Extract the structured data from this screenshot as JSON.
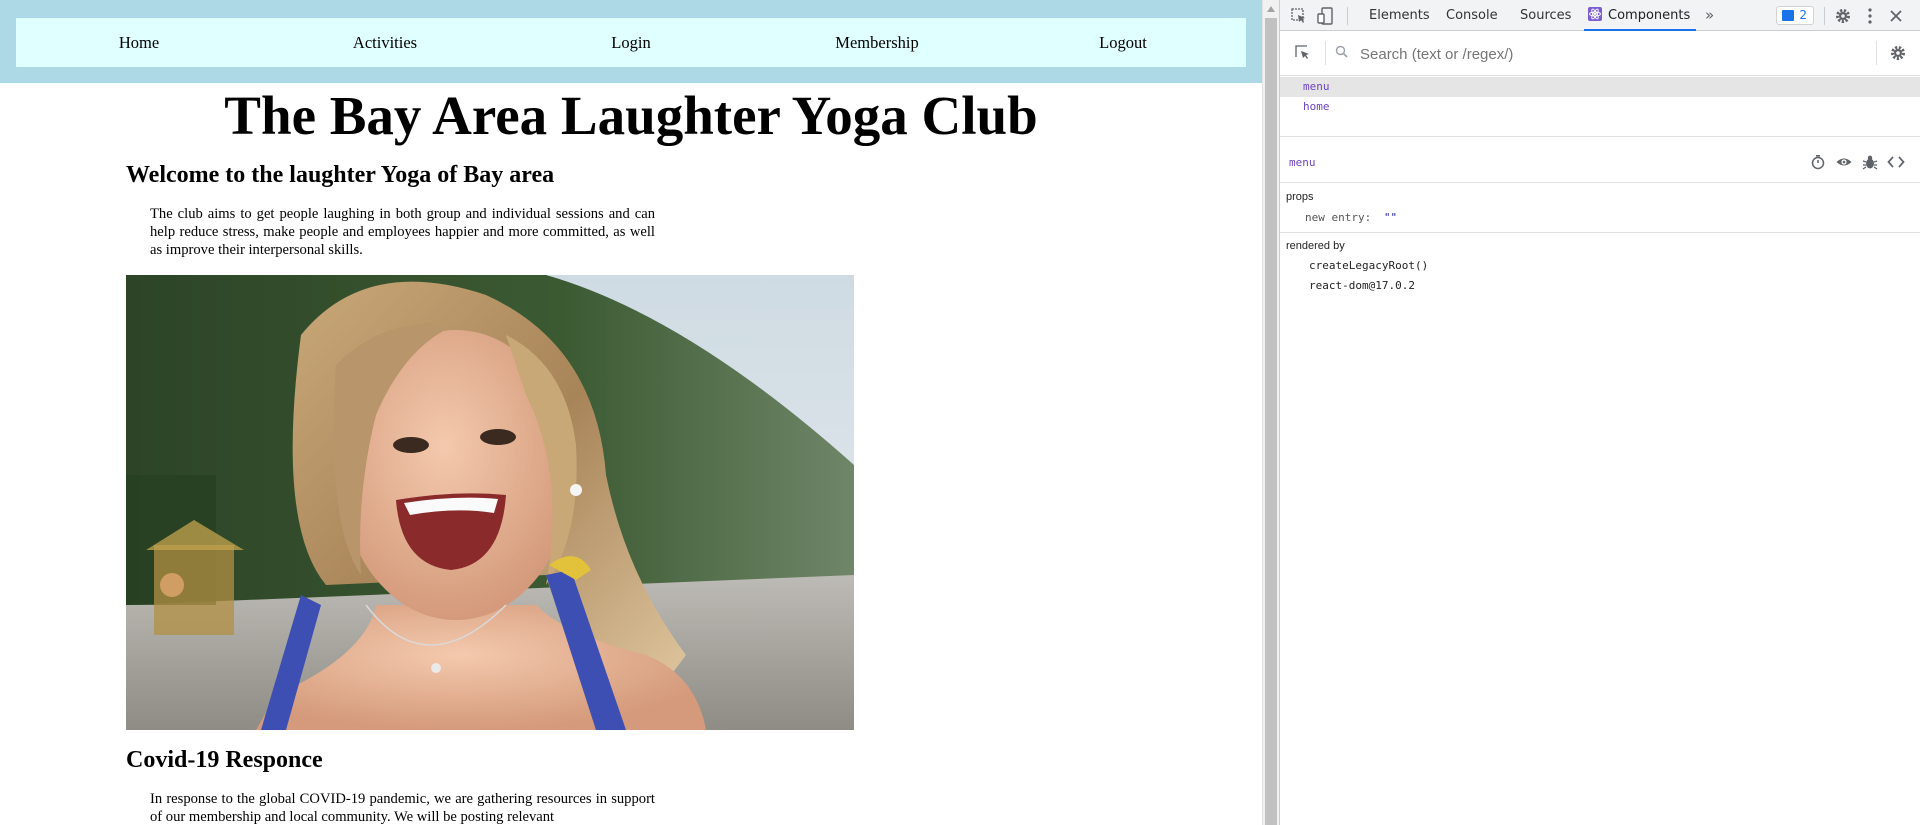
{
  "nav": {
    "items": [
      "Home",
      "Activities",
      "Login",
      "Membership",
      "Logout"
    ]
  },
  "site": {
    "title": "The Bay Area Laughter Yoga Club",
    "welcome_heading": "Welcome to the laughter Yoga of Bay area",
    "welcome_text": "The club aims to get people laughing in both group and individual sessions and can help reduce stress, make people and employees happier and more committed, as well as improve their interpersonal skills.",
    "covid_heading": "Covid-19 Responce",
    "covid_text": "In response to the global COVID-19 pandemic, we are gathering resources in support of our membership and local community. We will be posting relevant"
  },
  "devtools": {
    "tabs": [
      "Elements",
      "Console",
      "Sources",
      "Components"
    ],
    "active_tab": "Components",
    "issues_count": "2",
    "search_placeholder": "Search (text or /regex/)",
    "tree": [
      "menu",
      "home"
    ],
    "selected_component": "menu",
    "props_label": "props",
    "prop_key": "new entry:",
    "prop_value": "\"\"",
    "rendered_by_label": "rendered by",
    "rendered_by": [
      "createLegacyRoot()",
      "react-dom@17.0.2"
    ]
  },
  "colors": {
    "nav_band": "#add8e6",
    "nav_bar": "#e0ffff",
    "devtools_accent": "#1a73e8",
    "component_name": "#6f42c1"
  },
  "icons": [
    "inspect-element-icon",
    "device-toolbar-icon",
    "react-components-icon",
    "more-tabs-icon",
    "issues-icon",
    "settings-gear-icon",
    "kebab-menu-icon",
    "close-icon",
    "select-component-icon",
    "search-icon",
    "stopwatch-icon",
    "eye-icon",
    "bug-icon",
    "view-source-icon"
  ]
}
